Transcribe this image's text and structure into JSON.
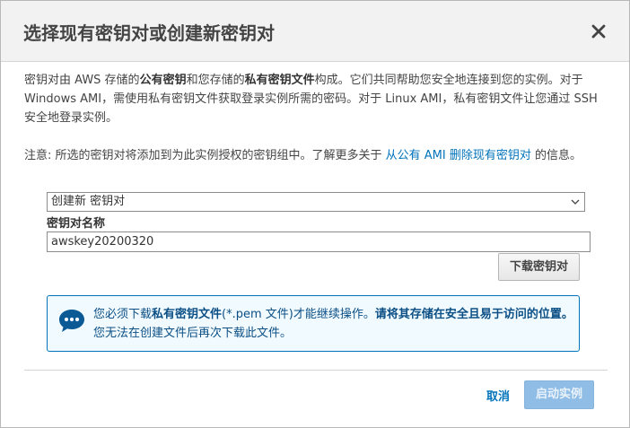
{
  "dialog": {
    "title": "选择现有密钥对或创建新密钥对",
    "close_icon": "close-icon"
  },
  "intro": {
    "t1": "密钥对由 AWS 存储的",
    "b1": "公有密钥",
    "t2": "和您存储的",
    "b2": "私有密钥文件",
    "t3": "构成。它们共同帮助您安全地连接到您的实例。对于 Windows AMI，需使用私有密钥文件获取登录实例所需的密码。对于 Linux AMI，私有密钥文件让您通过 SSH 安全地登录实例。"
  },
  "note": {
    "prefix": "注意: 所选的密钥对将添加到为此实例授权的密钥组中。了解更多关于 ",
    "link": "从公有 AMI 删除现有密钥对",
    "suffix": " 的信息。"
  },
  "keypair_select": {
    "value": "创建新 密钥对",
    "icon": "chevron-down-icon"
  },
  "keypair_name": {
    "label": "密钥对名称",
    "value": "awskey20200320"
  },
  "download_button": "下载密钥对",
  "info": {
    "icon": "chat-bubble-icon",
    "t1": "您必须下载",
    "b1": "私有密钥文件",
    "t2": "(*.pem 文件)才能继续操作。",
    "b2": "请将其存储在安全且易于访问的位置。",
    "t3": "您无法在创建文件后再次下载此文件。"
  },
  "footer": {
    "cancel": "取消",
    "launch": "启动实例"
  },
  "colors": {
    "accent": "#0073bb",
    "info_bg": "#f1faff",
    "disabled_button": "#8fbde6",
    "header_bg": "#f2f2f2"
  }
}
